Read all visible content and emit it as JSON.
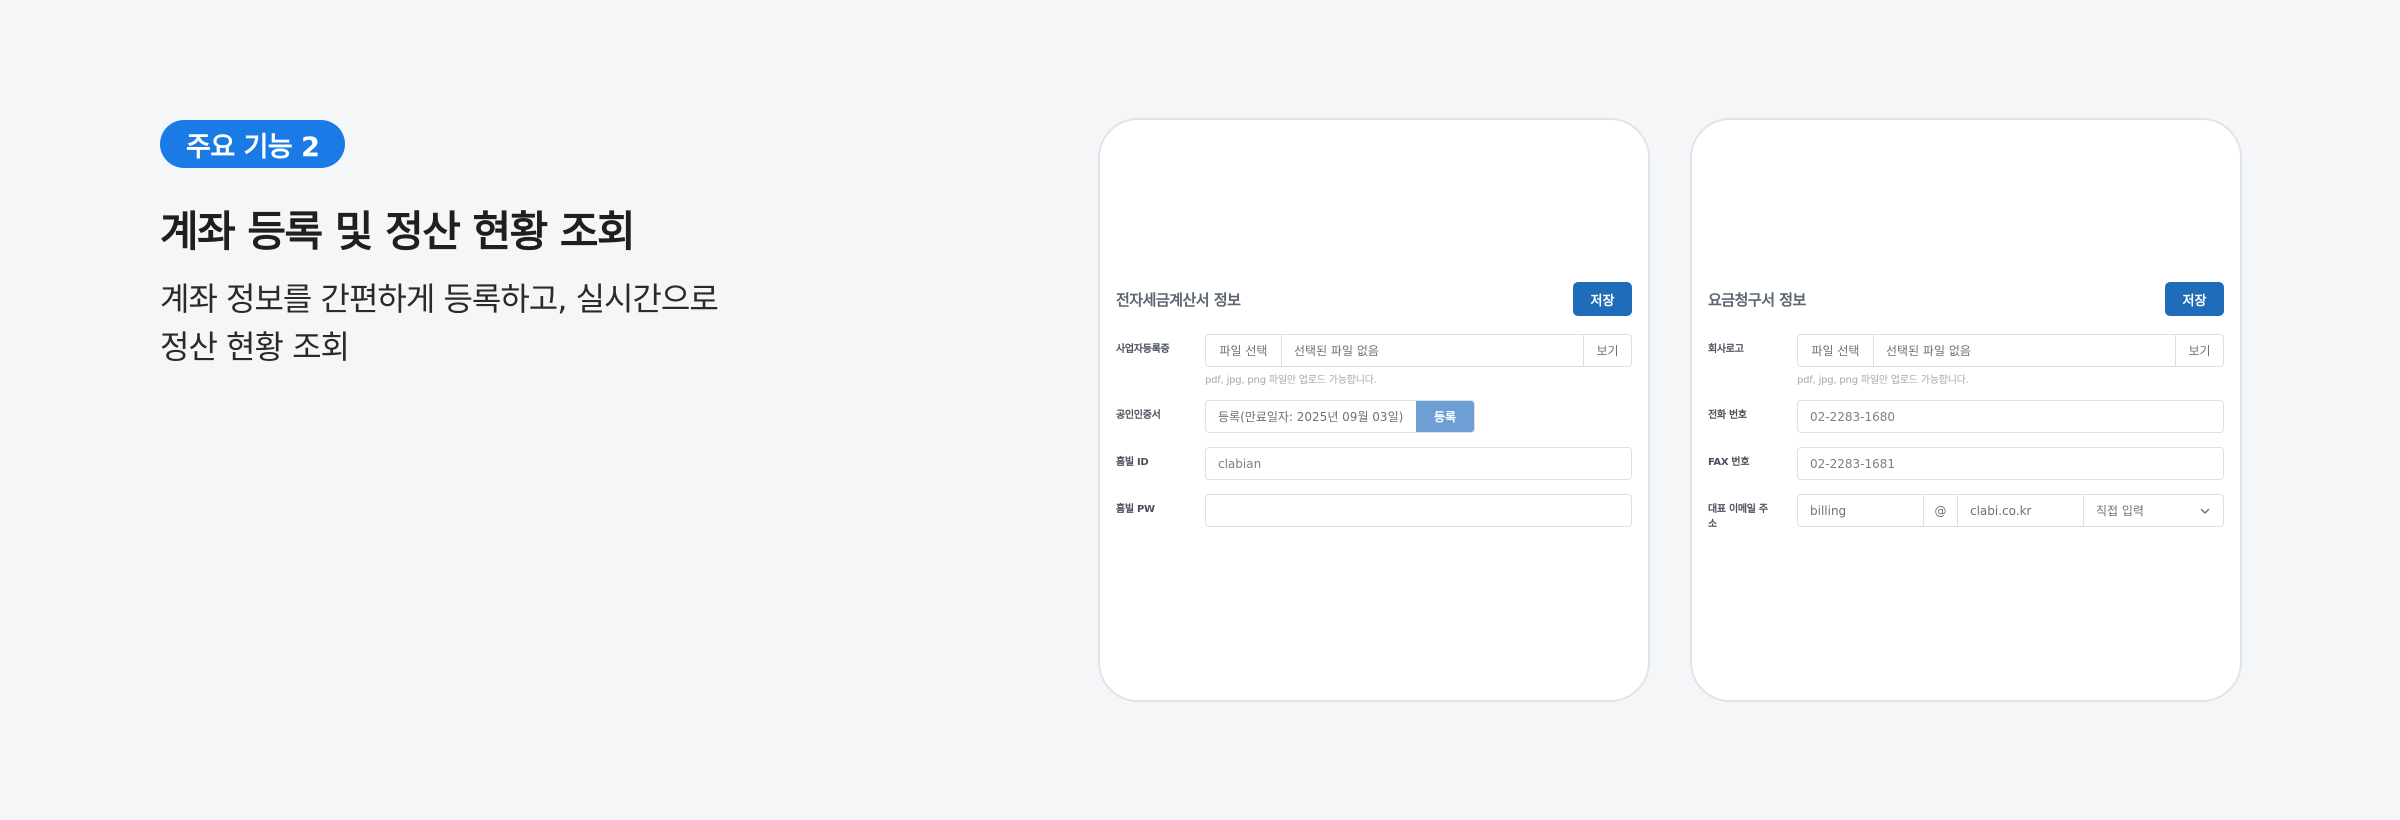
{
  "intro": {
    "badge": "주요 기능 2",
    "headline": "계좌 등록 및 정산 현황 조회",
    "description_line1": "계좌 정보를 간편하게 등록하고, 실시간으로",
    "description_line2": "정산 현황 조회"
  },
  "tax_invoice_card": {
    "title": "전자세금계산서 정보",
    "save_label": "저장",
    "business_reg": {
      "label": "사업자등록증",
      "choose_label": "파일 선택",
      "file_name": "선택된 파일 없음",
      "view_label": "보기",
      "hint": "pdf, jpg, png 파일만 업로드 가능합니다."
    },
    "certificate": {
      "label": "공인인증서",
      "value": "등록(만료일자: 2025년 09월 03일)",
      "register_label": "등록"
    },
    "hometax_id": {
      "label": "홈빌 ID",
      "value": "clabian"
    },
    "hometax_pw": {
      "label": "홈빌 PW",
      "value": ""
    }
  },
  "billing_card": {
    "title": "요금청구서 정보",
    "save_label": "저장",
    "company_logo": {
      "label": "회사로고",
      "choose_label": "파일 선택",
      "file_name": "선택된 파일 없음",
      "view_label": "보기",
      "hint": "pdf, jpg, png 파일만 업로드 가능합니다."
    },
    "phone": {
      "label": "전화 번호",
      "value": "02-2283-1680"
    },
    "fax": {
      "label": "FAX 번호",
      "value": "02-2283-1681"
    },
    "email": {
      "label_line1": "대표 이메일 주",
      "label_line2": "소",
      "local": "billing",
      "at": "@",
      "domain": "clabi.co.kr",
      "select_value": "직접 입력"
    }
  },
  "colors": {
    "background": "#f5f6f8",
    "badge": "#1a7be6",
    "save_button": "#1f6cb8",
    "register_button": "#6d9ed4"
  }
}
